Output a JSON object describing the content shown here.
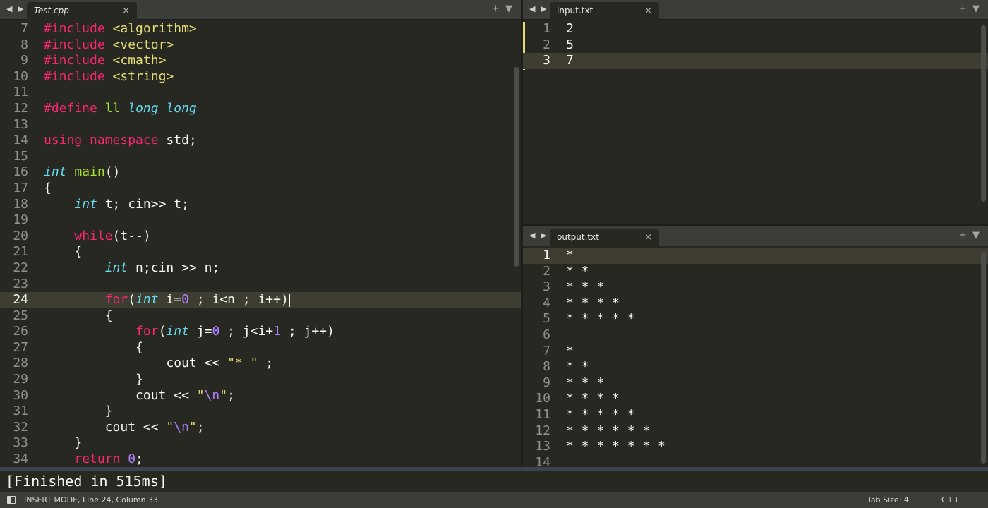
{
  "editor": {
    "tab_title": "Test.cpp",
    "close_glyph": "×",
    "nav_glyph": "◀ ▶",
    "plus_glyph": "+",
    "menu_glyph": "▼",
    "lines": [
      {
        "n": "7",
        "tokens": [
          {
            "t": "#include",
            "c": "kw"
          },
          {
            "t": " ",
            "c": ""
          },
          {
            "t": "<algorithm>",
            "c": "st"
          }
        ]
      },
      {
        "n": "8",
        "tokens": [
          {
            "t": "#include",
            "c": "kw"
          },
          {
            "t": " ",
            "c": ""
          },
          {
            "t": "<vector>",
            "c": "st"
          }
        ]
      },
      {
        "n": "9",
        "tokens": [
          {
            "t": "#include",
            "c": "kw"
          },
          {
            "t": " ",
            "c": ""
          },
          {
            "t": "<cmath>",
            "c": "st"
          }
        ]
      },
      {
        "n": "10",
        "tokens": [
          {
            "t": "#include",
            "c": "kw"
          },
          {
            "t": " ",
            "c": ""
          },
          {
            "t": "<string>",
            "c": "st"
          }
        ]
      },
      {
        "n": "11",
        "tokens": []
      },
      {
        "n": "12",
        "tokens": [
          {
            "t": "#define",
            "c": "kw"
          },
          {
            "t": " ",
            "c": ""
          },
          {
            "t": "ll",
            "c": "fn"
          },
          {
            "t": " ",
            "c": ""
          },
          {
            "t": "long long",
            "c": "ty"
          }
        ]
      },
      {
        "n": "13",
        "tokens": []
      },
      {
        "n": "14",
        "tokens": [
          {
            "t": "using",
            "c": "kw"
          },
          {
            "t": " ",
            "c": ""
          },
          {
            "t": "namespace",
            "c": "kw"
          },
          {
            "t": " std;",
            "c": ""
          }
        ]
      },
      {
        "n": "15",
        "tokens": []
      },
      {
        "n": "16",
        "tokens": [
          {
            "t": "int",
            "c": "ty"
          },
          {
            "t": " ",
            "c": ""
          },
          {
            "t": "main",
            "c": "fn"
          },
          {
            "t": "()",
            "c": ""
          }
        ]
      },
      {
        "n": "17",
        "tokens": [
          {
            "t": "{",
            "c": ""
          }
        ]
      },
      {
        "n": "18",
        "tokens": [
          {
            "t": "    ",
            "c": ""
          },
          {
            "t": "int",
            "c": "ty"
          },
          {
            "t": " t; cin>> t;",
            "c": ""
          }
        ]
      },
      {
        "n": "19",
        "tokens": []
      },
      {
        "n": "20",
        "tokens": [
          {
            "t": "    ",
            "c": ""
          },
          {
            "t": "while",
            "c": "kw"
          },
          {
            "t": "(t--)",
            "c": ""
          }
        ]
      },
      {
        "n": "21",
        "tokens": [
          {
            "t": "    {",
            "c": ""
          }
        ]
      },
      {
        "n": "22",
        "tokens": [
          {
            "t": "        ",
            "c": ""
          },
          {
            "t": "int",
            "c": "ty"
          },
          {
            "t": " n;cin >> n;",
            "c": ""
          }
        ]
      },
      {
        "n": "23",
        "tokens": []
      },
      {
        "n": "24",
        "tokens": [
          {
            "t": "        ",
            "c": ""
          },
          {
            "t": "for",
            "c": "kw"
          },
          {
            "t": "(",
            "c": ""
          },
          {
            "t": "int",
            "c": "ty"
          },
          {
            "t": " i=",
            "c": ""
          },
          {
            "t": "0",
            "c": "nu"
          },
          {
            "t": " ; i<n ; i++)",
            "c": ""
          }
        ]
      },
      {
        "n": "25",
        "tokens": [
          {
            "t": "        {",
            "c": ""
          }
        ]
      },
      {
        "n": "26",
        "tokens": [
          {
            "t": "            ",
            "c": ""
          },
          {
            "t": "for",
            "c": "kw"
          },
          {
            "t": "(",
            "c": ""
          },
          {
            "t": "int",
            "c": "ty"
          },
          {
            "t": " j=",
            "c": ""
          },
          {
            "t": "0",
            "c": "nu"
          },
          {
            "t": " ; j<i+",
            "c": ""
          },
          {
            "t": "1",
            "c": "nu"
          },
          {
            "t": " ; j++)",
            "c": ""
          }
        ]
      },
      {
        "n": "27",
        "tokens": [
          {
            "t": "            {",
            "c": ""
          }
        ]
      },
      {
        "n": "28",
        "tokens": [
          {
            "t": "                cout << ",
            "c": ""
          },
          {
            "t": "\"* \"",
            "c": "st"
          },
          {
            "t": " ;",
            "c": ""
          }
        ]
      },
      {
        "n": "29",
        "tokens": [
          {
            "t": "            }",
            "c": ""
          }
        ]
      },
      {
        "n": "30",
        "tokens": [
          {
            "t": "            cout << ",
            "c": ""
          },
          {
            "t": "\"",
            "c": "st"
          },
          {
            "t": "\\n",
            "c": "nu"
          },
          {
            "t": "\"",
            "c": "st"
          },
          {
            "t": ";",
            "c": ""
          }
        ]
      },
      {
        "n": "31",
        "tokens": [
          {
            "t": "        }",
            "c": ""
          }
        ]
      },
      {
        "n": "32",
        "tokens": [
          {
            "t": "        cout << ",
            "c": ""
          },
          {
            "t": "\"",
            "c": "st"
          },
          {
            "t": "\\n",
            "c": "nu"
          },
          {
            "t": "\"",
            "c": "st"
          },
          {
            "t": ";",
            "c": ""
          }
        ]
      },
      {
        "n": "33",
        "tokens": [
          {
            "t": "    }",
            "c": ""
          }
        ]
      },
      {
        "n": "34",
        "tokens": [
          {
            "t": "    ",
            "c": ""
          },
          {
            "t": "return",
            "c": "kw"
          },
          {
            "t": " ",
            "c": ""
          },
          {
            "t": "0",
            "c": "nu"
          },
          {
            "t": ";",
            "c": ""
          }
        ]
      }
    ],
    "current_line": "24"
  },
  "input": {
    "tab_title": "input.txt",
    "lines": [
      {
        "n": "1",
        "text": "2"
      },
      {
        "n": "2",
        "text": "5"
      },
      {
        "n": "3",
        "text": "7"
      }
    ],
    "current_line": "3"
  },
  "output": {
    "tab_title": "output.txt",
    "lines": [
      {
        "n": "1",
        "text": "*"
      },
      {
        "n": "2",
        "text": "* *"
      },
      {
        "n": "3",
        "text": "* * *"
      },
      {
        "n": "4",
        "text": "* * * *"
      },
      {
        "n": "5",
        "text": "* * * * *"
      },
      {
        "n": "6",
        "text": ""
      },
      {
        "n": "7",
        "text": "*"
      },
      {
        "n": "8",
        "text": "* *"
      },
      {
        "n": "9",
        "text": "* * *"
      },
      {
        "n": "10",
        "text": "* * * *"
      },
      {
        "n": "11",
        "text": "* * * * *"
      },
      {
        "n": "12",
        "text": "* * * * * *"
      },
      {
        "n": "13",
        "text": "* * * * * * *"
      },
      {
        "n": "14",
        "text": ""
      }
    ],
    "current_line": "1"
  },
  "console": {
    "text": "[Finished in 515ms]"
  },
  "statusbar": {
    "mode": "INSERT MODE, Line 24, Column 33",
    "tab_size": "Tab Size: 4",
    "syntax": "C++"
  },
  "colors": {
    "bg": "#272822",
    "keyword": "#f92672",
    "string": "#e6db74",
    "type": "#66d9ef",
    "function": "#a6e22e",
    "number": "#ae81ff"
  }
}
